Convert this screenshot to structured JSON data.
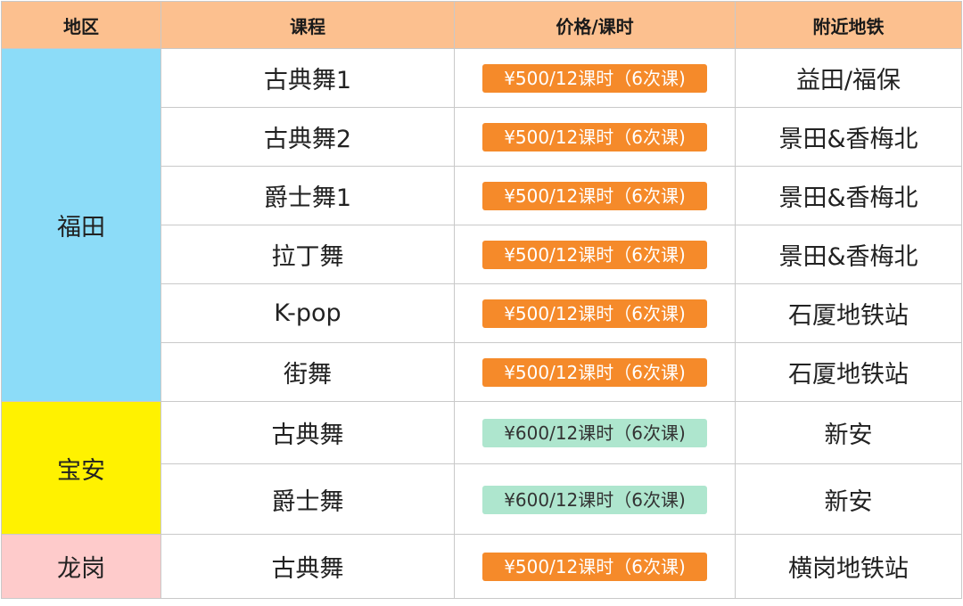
{
  "header": {
    "region": "地区",
    "course": "课程",
    "price": "价格/课时",
    "metro": "附近地铁"
  },
  "regions": [
    {
      "name": "福田",
      "color": "#8cdcf8",
      "rows": [
        {
          "course": "古典舞1",
          "price": "¥500/12课时（6次课)",
          "price_style": "orange",
          "metro": "益田/福保"
        },
        {
          "course": "古典舞2",
          "price": "¥500/12课时（6次课)",
          "price_style": "orange",
          "metro": "景田&香梅北"
        },
        {
          "course": "爵士舞1",
          "price": "¥500/12课时（6次课)",
          "price_style": "orange",
          "metro": "景田&香梅北"
        },
        {
          "course": "拉丁舞",
          "price": "¥500/12课时（6次课)",
          "price_style": "orange",
          "metro": "景田&香梅北"
        },
        {
          "course": "K-pop",
          "price": "¥500/12课时（6次课)",
          "price_style": "orange",
          "metro": "石厦地铁站"
        },
        {
          "course": "街舞",
          "price": "¥500/12课时（6次课)",
          "price_style": "orange",
          "metro": "石厦地铁站"
        }
      ]
    },
    {
      "name": "宝安",
      "color": "#fff200",
      "rows": [
        {
          "course": "古典舞",
          "price": "¥600/12课时（6次课)",
          "price_style": "green",
          "metro": "新安"
        },
        {
          "course": "爵士舞",
          "price": "¥600/12课时（6次课)",
          "price_style": "green",
          "metro": "新安"
        }
      ]
    },
    {
      "name": "龙岗",
      "color": "#fecbcb",
      "rows": [
        {
          "course": "古典舞",
          "price": "¥500/12课时（6次课)",
          "price_style": "orange",
          "metro": "横岗地铁站"
        }
      ]
    }
  ],
  "colors": {
    "header_bg": "#fcc08f",
    "price_orange": "#f58a2a",
    "price_green": "#aee6ce",
    "grid": "#c9c9c9"
  }
}
